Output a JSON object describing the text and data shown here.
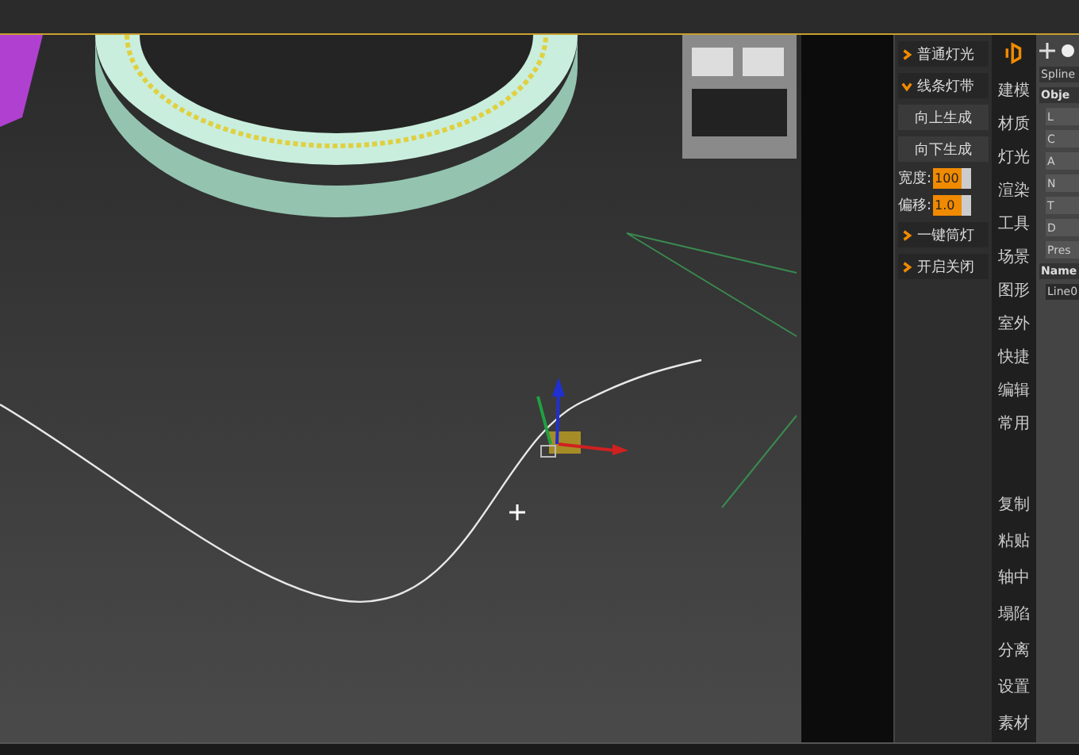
{
  "plugin_panel": {
    "items": [
      {
        "kind": "section",
        "label": "普通灯光",
        "expanded": false
      },
      {
        "kind": "section",
        "label": "线条灯带",
        "expanded": true
      },
      {
        "kind": "button",
        "label": "向上生成"
      },
      {
        "kind": "button",
        "label": "向下生成"
      },
      {
        "kind": "spinner",
        "label": "宽度:",
        "value": "100"
      },
      {
        "kind": "spinner",
        "label": "偏移:",
        "value": "1.0"
      },
      {
        "kind": "section",
        "label": "一键筒灯",
        "expanded": false
      },
      {
        "kind": "section",
        "label": "开启关闭",
        "expanded": false
      }
    ]
  },
  "sidebar": {
    "top_items": [
      "建模",
      "材质",
      "灯光",
      "渲染",
      "工具",
      "场景",
      "图形",
      "室外",
      "快捷",
      "编辑",
      "常用"
    ],
    "bottom_items": [
      "复制",
      "粘贴",
      "轴中",
      "塌陷",
      "分离",
      "设置",
      "素材"
    ]
  },
  "command_panel": {
    "dropdown": "Spline",
    "rollouts": [
      {
        "title": "Obje",
        "buttons": [
          "L",
          "C",
          "A",
          "N",
          "T",
          "D",
          "Pres"
        ]
      },
      {
        "title": "Name",
        "field": "Line0"
      }
    ]
  }
}
